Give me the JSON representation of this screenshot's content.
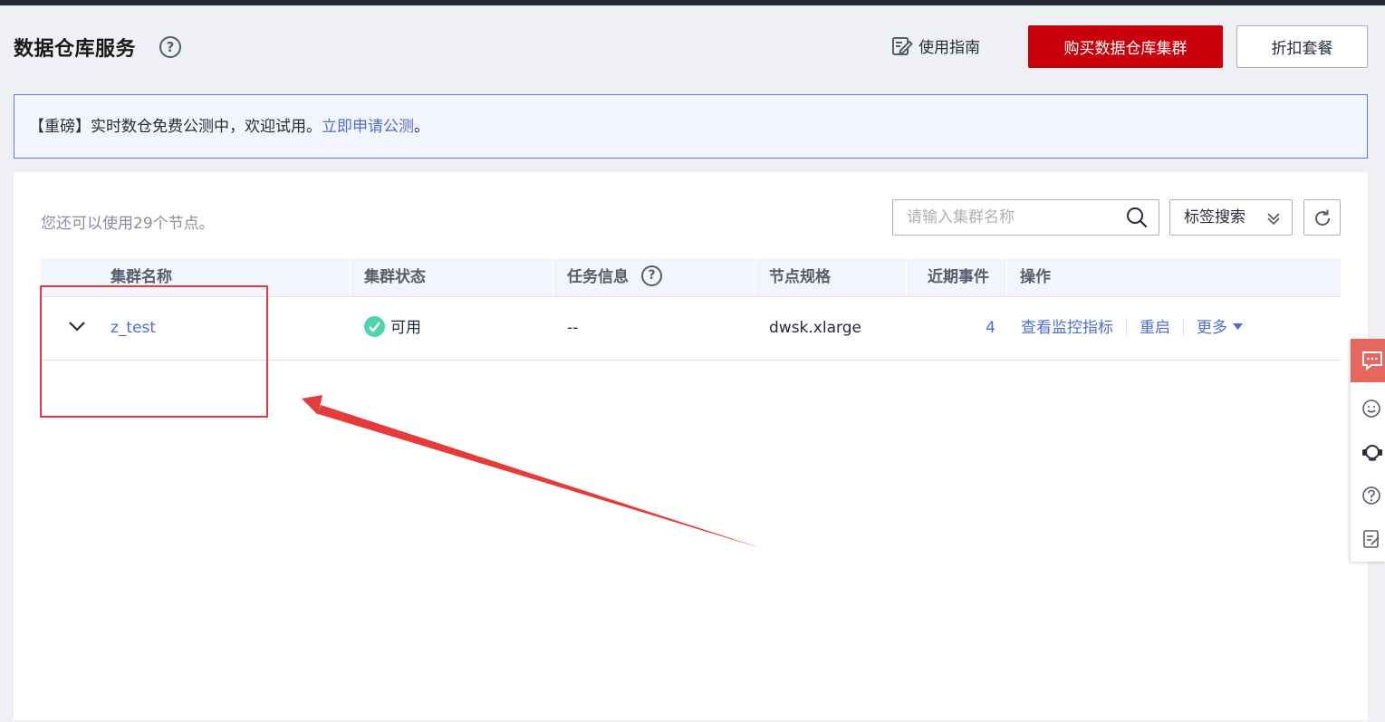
{
  "header": {
    "title": "数据仓库服务",
    "help_icon_glyph": "?",
    "guide_label": "使用指南",
    "buy_button": "购买数据仓库集群",
    "discount_button": "折扣套餐"
  },
  "notice": {
    "prefix": "【重磅】实时数仓免费公测中，欢迎试用。",
    "link_text": "立即申请公测",
    "suffix": "。"
  },
  "toolbar": {
    "quota_text": "您还可以使用29个节点。",
    "search_placeholder": "请输入集群名称",
    "tag_search_label": "标签搜索"
  },
  "table": {
    "columns": [
      "集群名称",
      "集群状态",
      "任务信息",
      "节点规格",
      "近期事件",
      "操作"
    ],
    "rows": [
      {
        "name": "z_test",
        "status": "可用",
        "task": "--",
        "spec": "dwsk.xlarge",
        "events": "4",
        "actions": [
          "查看监控指标",
          "重启",
          "更多"
        ]
      }
    ]
  },
  "colors": {
    "primary_red": "#c7000b",
    "link_blue": "#526ecc",
    "status_green": "#50d4ab",
    "annotation_red": "#e63b3b",
    "chat_bg": "#e5675f"
  },
  "icons": {
    "guide": "note-edit-icon",
    "search": "search-icon",
    "tag_chevron": "double-chevron-down-icon",
    "refresh": "refresh-icon",
    "expand": "chevron-down-icon",
    "status": "check-circle-icon",
    "more": "caret-down-icon",
    "side": [
      "chat-icon",
      "smile-icon",
      "headset-icon",
      "help-icon",
      "feedback-icon"
    ]
  }
}
